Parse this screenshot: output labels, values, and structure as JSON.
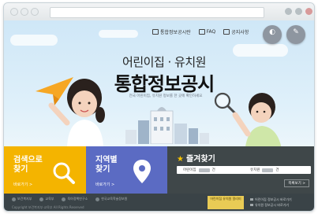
{
  "header_nav": {
    "items": [
      {
        "label": "통합정보공시란",
        "icon": "document-icon"
      },
      {
        "label": "FAQ",
        "icon": "question-icon"
      },
      {
        "label": "공지사항",
        "icon": "notice-icon"
      }
    ]
  },
  "circle_buttons": [
    {
      "glyph": "◐",
      "icon": "contrast-icon"
    },
    {
      "glyph": "✎",
      "icon": "edit-icon"
    }
  ],
  "hero": {
    "subtitle": "어린이집 · 유치원",
    "title": "통합정보공시",
    "description": "전국 어린이집, 유치원 정보를 한 곳에 확인하세요"
  },
  "cards": {
    "search": {
      "title": "검색으로\n찾기",
      "more": "바로가기 >",
      "icon": "magnifier-icon",
      "color": "#f4b400"
    },
    "region": {
      "title": "지역별\n찾기",
      "more": "바로가기 >",
      "icon": "map-pin-icon",
      "color": "#5b6bc3"
    }
  },
  "favorites": {
    "title": "즐겨찾기",
    "star_color": "#f7c300",
    "daycare_label": "어린이집",
    "daycare_count": "건",
    "kindergarten_label": "유치원",
    "kindergarten_count": "건",
    "more": "목록보기 >"
  },
  "footer": {
    "logos": [
      "보건복지부",
      "교육부",
      "육아정책연구소",
      "한국교육학술정보원"
    ],
    "copyright": "Copyright 보건복지부·교육부 All Rights Reserved",
    "banner": "어린이집 유치원 알리미",
    "side_links": [
      "어린이집 정보공시 바로가기",
      "유치원 정보공시 바로가기"
    ]
  }
}
